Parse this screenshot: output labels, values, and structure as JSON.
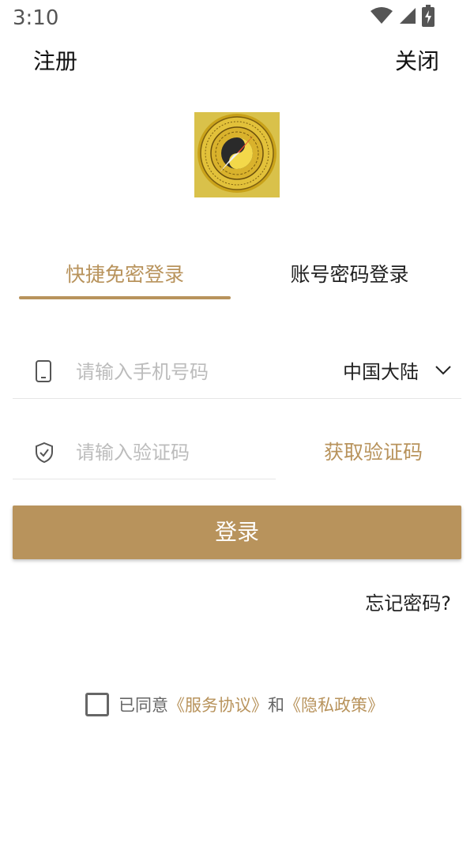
{
  "status_bar": {
    "time": "3:10",
    "icons": [
      "wifi-icon",
      "signal-icon",
      "battery-charging-icon"
    ]
  },
  "topbar": {
    "register_label": "注册",
    "close_label": "关闭"
  },
  "logo": {
    "icon": "compass-logo-icon"
  },
  "tabs": [
    {
      "label": "快捷免密登录",
      "active": true
    },
    {
      "label": "账号密码登录",
      "active": false
    }
  ],
  "phone_field": {
    "icon": "phone-icon",
    "placeholder": "请输入手机号码",
    "value": "",
    "region": "中国大陆",
    "region_icon": "chevron-down-icon"
  },
  "code_field": {
    "icon": "shield-check-icon",
    "placeholder": "请输入验证码",
    "value": "",
    "get_code_label": "获取验证码"
  },
  "login_button": {
    "label": "登录"
  },
  "forgot_password": {
    "label": "忘记密码?"
  },
  "agreement": {
    "checked": false,
    "prefix": "已同意",
    "service_link": "《服务协议》",
    "conjunction": "和",
    "privacy_link": "《隐私政策》"
  },
  "colors": {
    "accent": "#b8935c",
    "logo_background": "#d9c14a",
    "placeholder": "#bcbcbc",
    "text": "#222222"
  }
}
